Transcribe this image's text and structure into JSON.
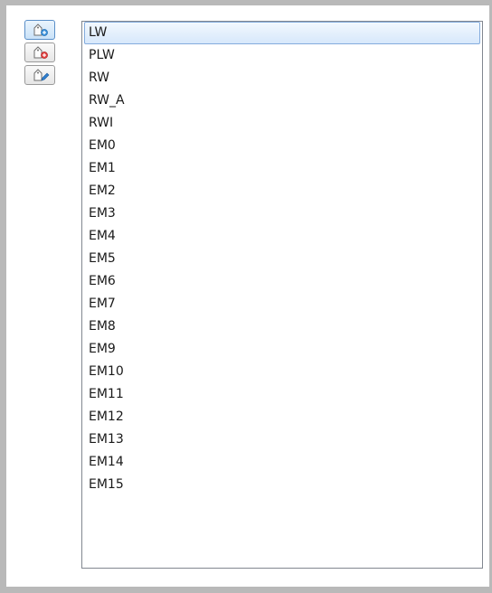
{
  "toolbar": {
    "buttons": [
      {
        "icon": "tag-add-icon",
        "active": true
      },
      {
        "icon": "tag-delete-icon",
        "active": false
      },
      {
        "icon": "tag-edit-icon",
        "active": false
      }
    ]
  },
  "list": {
    "selected_index": 0,
    "items": [
      "LW",
      "PLW",
      "RW",
      "RW_A",
      "RWI",
      "EM0",
      "EM1",
      "EM2",
      "EM3",
      "EM4",
      "EM5",
      "EM6",
      "EM7",
      "EM8",
      "EM9",
      "EM10",
      "EM11",
      "EM12",
      "EM13",
      "EM14",
      "EM15"
    ]
  },
  "colors": {
    "selection_border": "#84acdd",
    "selection_fill": "#d7e8fb",
    "frame": "#b9b9b9"
  }
}
